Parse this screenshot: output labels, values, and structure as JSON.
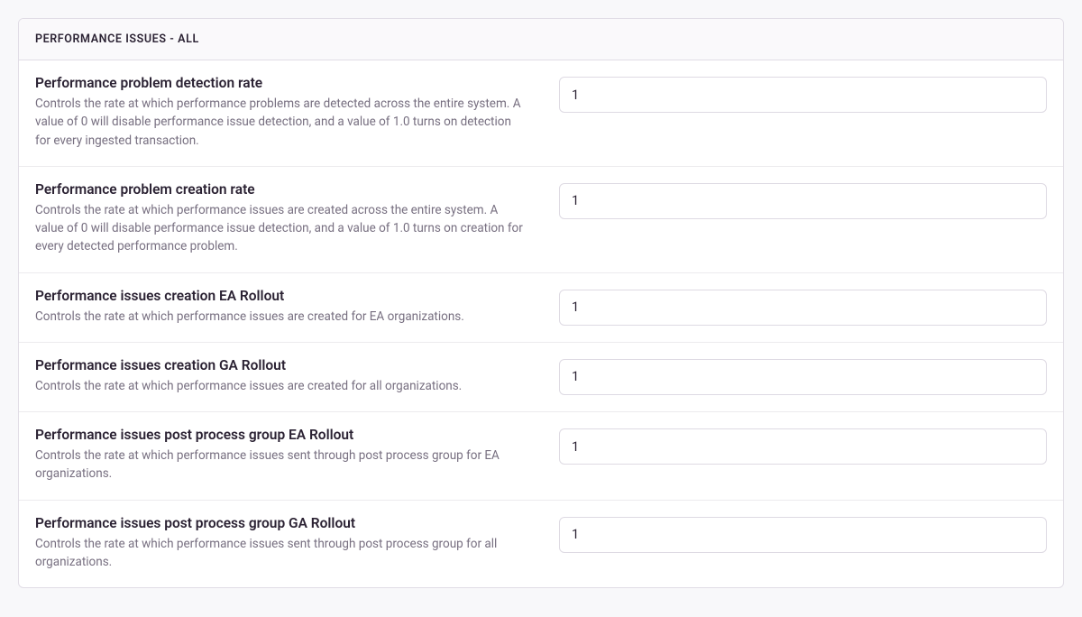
{
  "panel": {
    "header": "PERFORMANCE ISSUES - ALL",
    "rows": [
      {
        "title": "Performance problem detection rate",
        "desc": "Controls the rate at which performance problems are detected across the entire system. A value of 0 will disable performance issue detection, and a value of 1.0 turns on detection for every ingested transaction.",
        "value": "1"
      },
      {
        "title": "Performance problem creation rate",
        "desc": "Controls the rate at which performance issues are created across the entire system. A value of 0 will disable performance issue detection, and a value of 1.0 turns on creation for every detected performance problem.",
        "value": "1"
      },
      {
        "title": "Performance issues creation EA Rollout",
        "desc": "Controls the rate at which performance issues are created for EA organizations.",
        "value": "1"
      },
      {
        "title": "Performance issues creation GA Rollout",
        "desc": "Controls the rate at which performance issues are created for all organizations.",
        "value": "1"
      },
      {
        "title": "Performance issues post process group EA Rollout",
        "desc": "Controls the rate at which performance issues sent through post process group for EA organizations.",
        "value": "1"
      },
      {
        "title": "Performance issues post process group GA Rollout",
        "desc": "Controls the rate at which performance issues sent through post process group for all organizations.",
        "value": "1"
      }
    ]
  }
}
